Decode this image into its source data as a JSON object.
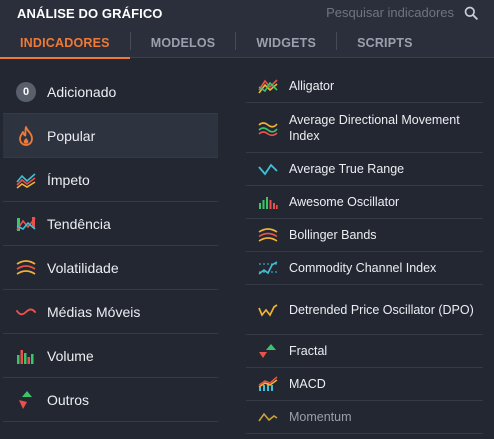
{
  "header": {
    "title": "ANÁLISE DO GRÁFICO",
    "search_placeholder": "Pesquisar indicadores"
  },
  "tabs": [
    {
      "label": "INDICADORES",
      "active": true
    },
    {
      "label": "MODELOS",
      "active": false
    },
    {
      "label": "WIDGETS",
      "active": false
    },
    {
      "label": "SCRIPTS",
      "active": false
    }
  ],
  "categories": [
    {
      "label": "Adicionado",
      "badge": "0",
      "icon": "count-badge"
    },
    {
      "label": "Popular",
      "icon": "flame-icon",
      "active": true
    },
    {
      "label": "Ímpeto",
      "icon": "momentum-lines-icon"
    },
    {
      "label": "Tendência",
      "icon": "trend-icon"
    },
    {
      "label": "Volatilidade",
      "icon": "volatility-waves-icon"
    },
    {
      "label": "Médias Móveis",
      "icon": "moving-average-icon"
    },
    {
      "label": "Volume",
      "icon": "volume-bars-icon"
    },
    {
      "label": "Outros",
      "icon": "arrows-icon"
    }
  ],
  "indicators": [
    {
      "label": "Alligator",
      "icon": "alligator-icon"
    },
    {
      "label": "Average Directional Movement Index",
      "icon": "adx-icon"
    },
    {
      "label": "Average True Range",
      "icon": "atr-icon"
    },
    {
      "label": "Awesome Oscillator",
      "icon": "awesome-oscillator-icon"
    },
    {
      "label": "Bollinger Bands",
      "icon": "bollinger-icon"
    },
    {
      "label": "Commodity Channel Index",
      "icon": "cci-icon"
    },
    {
      "label": "Detrended Price Oscillator (DPO)",
      "icon": "dpo-icon"
    },
    {
      "label": "Fractal",
      "icon": "fractal-icon"
    },
    {
      "label": "MACD",
      "icon": "macd-icon"
    },
    {
      "label": "Momentum",
      "icon": "momentum-icon"
    }
  ],
  "colors": {
    "accent": "#f07a35",
    "background": "#232732",
    "header": "#2b2f3b"
  }
}
